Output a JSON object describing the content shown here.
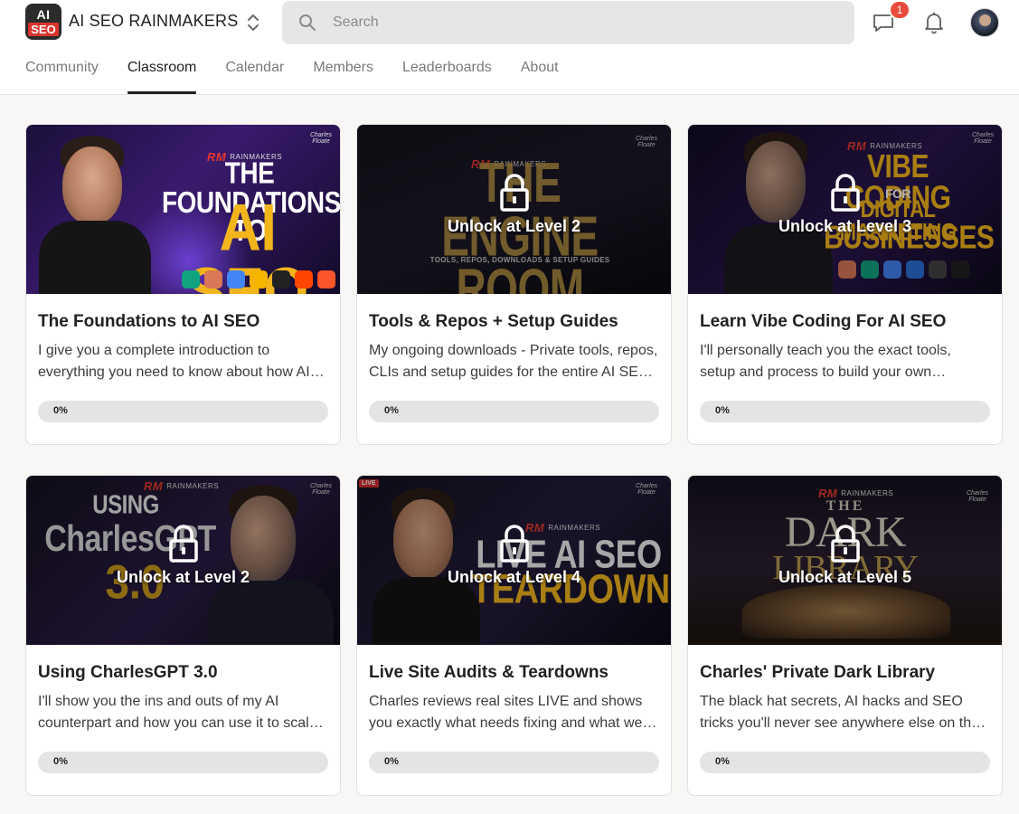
{
  "header": {
    "logo": {
      "line1": "AI",
      "line2": "SEO"
    },
    "brand": "AI SEO RAINMAKERS",
    "search_placeholder": "Search",
    "notification_count": "1"
  },
  "tabs": [
    {
      "label": "Community",
      "active": false
    },
    {
      "label": "Classroom",
      "active": true
    },
    {
      "label": "Calendar",
      "active": false
    },
    {
      "label": "Members",
      "active": false
    },
    {
      "label": "Leaderboards",
      "active": false
    },
    {
      "label": "About",
      "active": false
    }
  ],
  "courses": [
    {
      "title": "The Foundations to AI SEO",
      "description": "I give you a complete introduction to everything you need to know about how AI SEO works and how to use it.",
      "progress": 0,
      "progress_label": "0%",
      "locked": false,
      "lock_text": "",
      "art": {
        "line1": "THE FOUNDATIONS TO",
        "line2": "AI SEO",
        "brand": "RAINMAKERS",
        "signature": "Charles Floate"
      }
    },
    {
      "title": "Tools & Repos + Setup Guides",
      "description": "My ongoing downloads - Private tools, repos, CLIs and setup guides for the entire AI SEO stack.",
      "progress": 0,
      "progress_label": "0%",
      "locked": true,
      "lock_text": "Unlock at Level 2",
      "art": {
        "line1": "THE ENGINE ROOM",
        "line2": "TOOLS, REPOS, DOWNLOADS & SETUP GUIDES",
        "brand": "RAINMAKERS",
        "signature": "Charles Floate"
      }
    },
    {
      "title": "Learn Vibe Coding For AI SEO",
      "description": "I'll personally teach you the exact tools, setup and process to build your own dashboards and apps.",
      "progress": 0,
      "progress_label": "0%",
      "locked": true,
      "lock_text": "Unlock at Level 3",
      "art": {
        "line1": "VIBE CODING",
        "line2": "FOR",
        "line3": "DIGITAL MARKETING",
        "line4": "BUSINESSES",
        "brand": "RAINMAKERS",
        "signature": "Charles Floate"
      }
    },
    {
      "title": "Using CharlesGPT 3.0",
      "description": "I'll show you the ins and outs of my AI counterpart and how you can use it to scale your work.",
      "progress": 0,
      "progress_label": "0%",
      "locked": true,
      "lock_text": "Unlock at Level 2",
      "art": {
        "line1": "USING",
        "line2": "CharlesGPT",
        "line3": "3.0",
        "brand": "RAINMAKERS",
        "signature": "Charles Floate"
      }
    },
    {
      "title": "Live Site Audits & Teardowns",
      "description": "Charles reviews real sites LIVE and shows you exactly what needs fixing and what went wrong.",
      "progress": 0,
      "progress_label": "0%",
      "locked": true,
      "lock_text": "Unlock at Level 4",
      "art": {
        "line1": "LIVE AI SEO",
        "line2": "TEARDOWNS",
        "live": "LIVE",
        "brand": "RAINMAKERS",
        "signature": "Charles Floate"
      }
    },
    {
      "title": "Charles' Private Dark Library",
      "description": "The black hat secrets, AI hacks and SEO tricks you'll never see anywhere else on the internet.",
      "progress": 0,
      "progress_label": "0%",
      "locked": true,
      "lock_text": "Unlock at Level 5",
      "art": {
        "line1": "THE",
        "line2": "DARK",
        "line3": "LIBRARY",
        "brand": "RAINMAKERS",
        "signature": "Charles Floate"
      }
    }
  ],
  "colors": {
    "progress_track": "#e4e4e4",
    "progress_fill": "#e7c148",
    "badge": "#e84b3c",
    "brand_red": "#e23a2f",
    "art_gold": "#f2b51c"
  }
}
